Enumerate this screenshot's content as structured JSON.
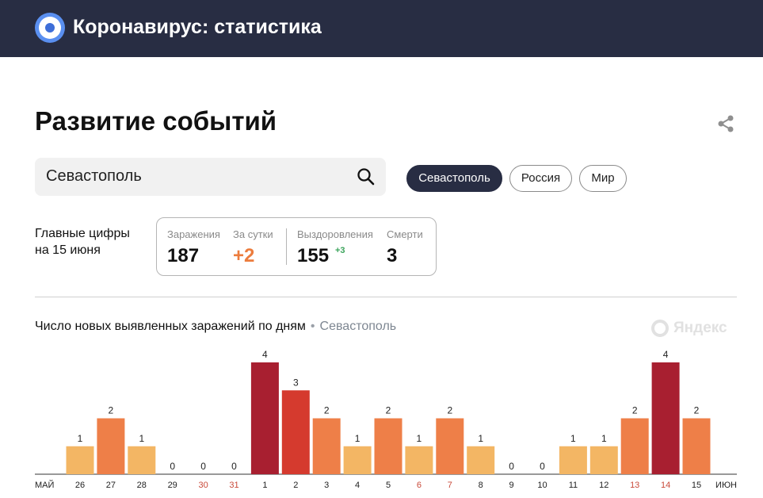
{
  "header": {
    "title": "Коронавирус: статистика"
  },
  "section": {
    "title": "Развитие событий"
  },
  "search": {
    "value": "Севастополь"
  },
  "filters": [
    "Севастополь",
    "Россия",
    "Мир"
  ],
  "summary": {
    "label_line1": "Главные цифры",
    "label_line2": "на 15 июня",
    "infections_label": "Заражения",
    "infections_value": "187",
    "daily_label": "За сутки",
    "daily_value": "+2",
    "recovered_label": "Выздоровления",
    "recovered_value": "155",
    "recovered_delta": "+3",
    "deaths_label": "Смерти",
    "deaths_value": "3"
  },
  "colors": {
    "accent_dark": "#282d43",
    "daily_orange": "#ec7c3d",
    "weekend_red": "#c94a3a"
  },
  "chart_data": {
    "type": "bar",
    "title": "Число новых выявленных заражений по дням",
    "subtitle": "Севастополь",
    "watermark": "Яндекс",
    "month_start": "МАЙ",
    "month_end": "ИЮН",
    "categories": [
      "26",
      "27",
      "28",
      "29",
      "30",
      "31",
      "1",
      "2",
      "3",
      "4",
      "5",
      "6",
      "7",
      "8",
      "9",
      "10",
      "11",
      "12",
      "13",
      "14",
      "15"
    ],
    "values": [
      1,
      2,
      1,
      0,
      0,
      0,
      4,
      3,
      2,
      1,
      2,
      1,
      2,
      1,
      0,
      0,
      1,
      1,
      2,
      4,
      2
    ],
    "weekend_categories": [
      "30",
      "31",
      "6",
      "7",
      "13",
      "14"
    ],
    "value_colors": {
      "1": "#f3b664",
      "2": "#ee7f48",
      "3": "#d53a2e",
      "4": "#a81f30"
    },
    "ylim": [
      0,
      4
    ]
  }
}
